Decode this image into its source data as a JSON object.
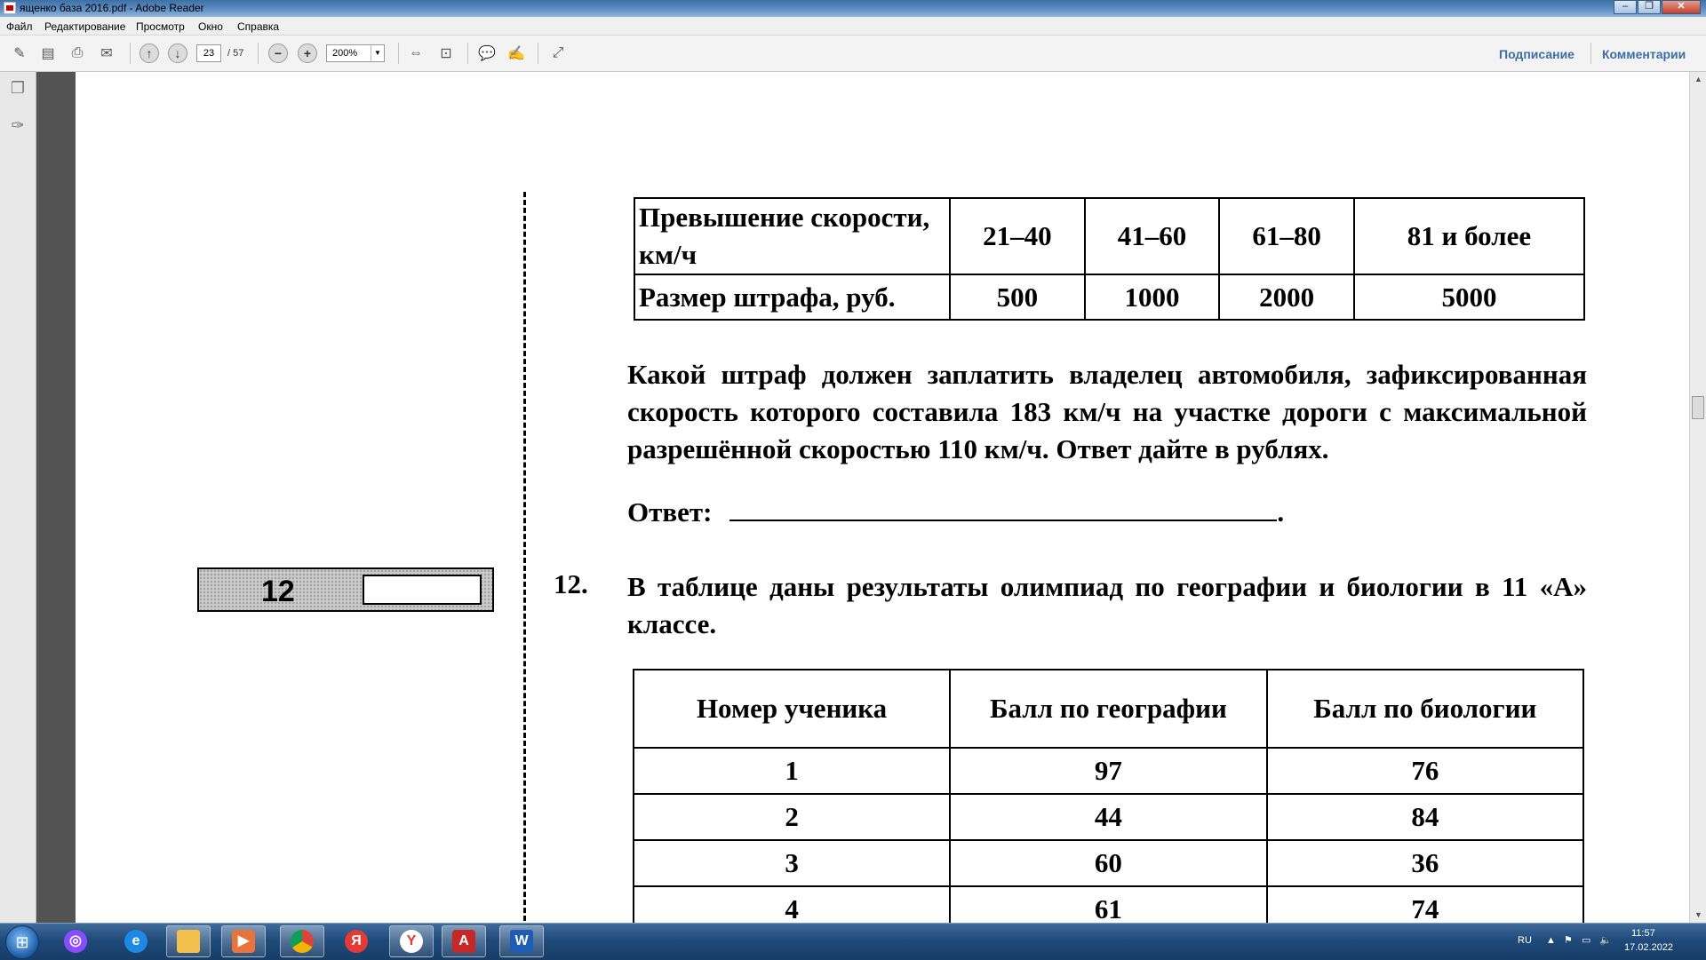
{
  "window": {
    "title": "ященко база 2016.pdf - Adobe Reader"
  },
  "menu": [
    "Файл",
    "Редактирование",
    "Просмотр",
    "Окно",
    "Справка"
  ],
  "toolbar": {
    "current_page": "23",
    "total_pages": "/ 57",
    "zoom": "200%",
    "sign_label": "Подписание",
    "comments_label": "Комментарии"
  },
  "document": {
    "fine_table": {
      "header": [
        "Превышение скорости, км/ч",
        "21–40",
        "41–60",
        "61–80",
        "81 и более"
      ],
      "row": [
        "Размер штрафа, руб.",
        "500",
        "1000",
        "2000",
        "5000"
      ]
    },
    "question_text": "Какой штраф должен заплатить владелец автомобиля, зафиксированная скорость которого составила 183 км/ч на участке дороги с максимальной разрешённой скоростью 110 км/ч. Ответ дайте в рублях.",
    "answer_label": "Ответ:",
    "answer_end": ".",
    "box_number": "12",
    "q12_number": "12.",
    "q12_text": "В таблице даны результаты олимпиад по географии и биологии в 11 «А» классе.",
    "results_table": {
      "header": [
        "Номер ученика",
        "Балл по географии",
        "Балл по биологии"
      ],
      "rows": [
        [
          "1",
          "97",
          "76"
        ],
        [
          "2",
          "44",
          "84"
        ],
        [
          "3",
          "60",
          "36"
        ],
        [
          "4",
          "61",
          "74"
        ]
      ]
    }
  },
  "taskbar": {
    "language": "RU",
    "time": "11:57",
    "date": "17.02.2022",
    "apps": [
      "alisa",
      "internet-explorer",
      "file-explorer",
      "media-player",
      "chrome",
      "yandex",
      "yandex-browser",
      "adobe-reader",
      "word"
    ]
  }
}
